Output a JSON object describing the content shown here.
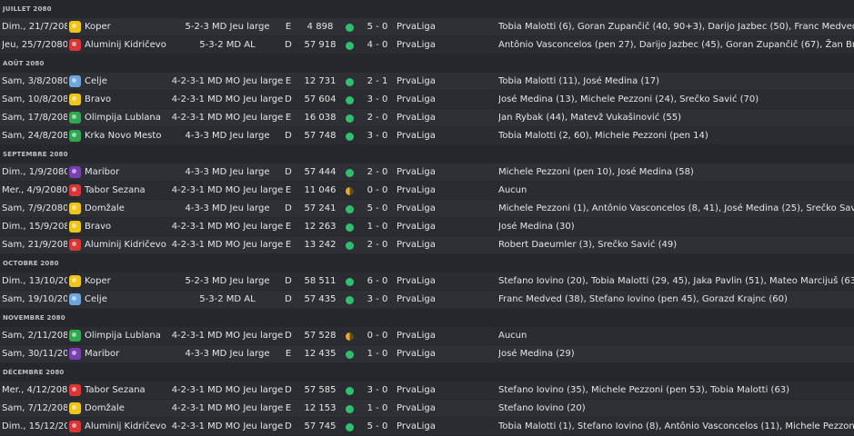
{
  "colors": {
    "win": "#2fbf6e",
    "draw": "#f0a91e"
  },
  "months": [
    {
      "label": "JUILLET 2080",
      "rows": [
        {
          "date": "Dim., 21/7/2080",
          "opponent": "Koper",
          "badge": "#f0c419",
          "tactic": "5-2-3 MD Jeu large",
          "venue": "E",
          "attendance": "4 898",
          "result": "win",
          "score": "5 - 0",
          "competition": "PrvaLiga",
          "scorers": "Tobia Malotti (6), Goran Zupančič (40, 90+3), Darijo Jazbec (50), Franc Medved (54)"
        },
        {
          "date": "Jeu, 25/7/2080",
          "opponent": "Aluminij Kidričevo",
          "badge": "#d93636",
          "tactic": "5-3-2 MD AL",
          "venue": "D",
          "attendance": "57 918",
          "result": "win",
          "score": "4 - 0",
          "competition": "PrvaLiga",
          "scorers": "Antônio Vasconcelos (pen 27), Darijo Jazbec (45), Goran Zupančič (67), Žan Brdik (83)"
        }
      ]
    },
    {
      "label": "AOÛT 2080",
      "rows": [
        {
          "date": "Sam, 3/8/2080",
          "opponent": "Celje",
          "badge": "#6aa7e0",
          "tactic": "4-2-3-1 MD MO Jeu large",
          "venue": "E",
          "attendance": "12 731",
          "result": "win",
          "score": "2 - 1",
          "competition": "PrvaLiga",
          "scorers": "Tobia Malotti (11), José Medina (17)"
        },
        {
          "date": "Sam, 10/8/2080",
          "opponent": "Bravo",
          "badge": "#f0c419",
          "tactic": "4-2-3-1 MD MO Jeu large",
          "venue": "D",
          "attendance": "57 604",
          "result": "win",
          "score": "3 - 0",
          "competition": "PrvaLiga",
          "scorers": "José Medina (13), Michele Pezzoni (24), Srečko Savić (70)"
        },
        {
          "date": "Sam, 17/8/2080",
          "opponent": "Olimpija Lublana",
          "badge": "#2fa84f",
          "tactic": "4-2-3-1 MD MO Jeu large",
          "venue": "E",
          "attendance": "16 038",
          "result": "win",
          "score": "2 - 0",
          "competition": "PrvaLiga",
          "scorers": "Jan Rybak (44), Matevž Vukašinović (55)"
        },
        {
          "date": "Sam, 24/8/2080",
          "opponent": "Krka Novo Mesto",
          "badge": "#2fa84f",
          "tactic": "4-3-3 MD Jeu large",
          "venue": "D",
          "attendance": "57 748",
          "result": "win",
          "score": "3 - 0",
          "competition": "PrvaLiga",
          "scorers": "Tobia Malotti (2, 60), Michele Pezzoni (pen 14)"
        }
      ]
    },
    {
      "label": "SEPTEMBRE 2080",
      "rows": [
        {
          "date": "Dim., 1/9/2080",
          "opponent": "Maribor",
          "badge": "#7a3fb0",
          "tactic": "4-3-3 MD Jeu large",
          "venue": "D",
          "attendance": "57 444",
          "result": "win",
          "score": "2 - 0",
          "competition": "PrvaLiga",
          "scorers": "Michele Pezzoni (pen 10), José Medina (58)"
        },
        {
          "date": "Mer., 4/9/2080",
          "opponent": "Tabor Sezana",
          "badge": "#d93636",
          "tactic": "4-2-3-1 MD MO Jeu large",
          "venue": "E",
          "attendance": "11 046",
          "result": "draw",
          "score": "0 - 0",
          "competition": "PrvaLiga",
          "scorers": "Aucun"
        },
        {
          "date": "Sam, 7/9/2080",
          "opponent": "Domžale",
          "badge": "#f0c419",
          "tactic": "4-3-3 MD Jeu large",
          "venue": "D",
          "attendance": "57 241",
          "result": "win",
          "score": "5 - 0",
          "competition": "PrvaLiga",
          "scorers": "Michele Pezzoni (1), Antônio Vasconcelos (8, 41), José Medina (25), Srečko Savić (55)"
        },
        {
          "date": "Dim., 15/9/2080",
          "opponent": "Bravo",
          "badge": "#f0c419",
          "tactic": "4-2-3-1 MD MO Jeu large",
          "venue": "E",
          "attendance": "12 263",
          "result": "win",
          "score": "1 - 0",
          "competition": "PrvaLiga",
          "scorers": "José Medina (30)"
        },
        {
          "date": "Sam, 21/9/2080",
          "opponent": "Aluminij Kidričevo",
          "badge": "#d93636",
          "tactic": "4-2-3-1 MD MO Jeu large",
          "venue": "E",
          "attendance": "13 242",
          "result": "win",
          "score": "2 - 0",
          "competition": "PrvaLiga",
          "scorers": "Robert Daeumler (3), Srečko Savić (49)"
        }
      ]
    },
    {
      "label": "OCTOBRE 2080",
      "rows": [
        {
          "date": "Dim., 13/10/2080",
          "opponent": "Koper",
          "badge": "#f0c419",
          "tactic": "5-2-3 MD Jeu large",
          "venue": "D",
          "attendance": "58 511",
          "result": "win",
          "score": "6 - 0",
          "competition": "PrvaLiga",
          "scorers": "Stefano Iovino (20), Tobia Malotti (29, 45), Jaka Pavlin (51), Mateo Marcijuš (63), Gorazd Kraj…"
        },
        {
          "date": "Sam, 19/10/2080",
          "opponent": "Celje",
          "badge": "#6aa7e0",
          "tactic": "5-3-2 MD AL",
          "venue": "D",
          "attendance": "57 435",
          "result": "win",
          "score": "3 - 0",
          "competition": "PrvaLiga",
          "scorers": "Franc Medved (38), Stefano Iovino (pen 45), Gorazd Krajnc (60)"
        }
      ]
    },
    {
      "label": "NOVEMBRE 2080",
      "rows": [
        {
          "date": "Sam, 2/11/2080",
          "opponent": "Olimpija Lublana",
          "badge": "#2fa84f",
          "tactic": "4-2-3-1 MD MO Jeu large",
          "venue": "D",
          "attendance": "57 528",
          "result": "draw",
          "score": "0 - 0",
          "competition": "PrvaLiga",
          "scorers": "Aucun"
        },
        {
          "date": "Sam, 30/11/2080",
          "opponent": "Maribor",
          "badge": "#7a3fb0",
          "tactic": "4-3-3 MD Jeu large",
          "venue": "E",
          "attendance": "12 435",
          "result": "win",
          "score": "1 - 0",
          "competition": "PrvaLiga",
          "scorers": "José Medina (29)"
        }
      ]
    },
    {
      "label": "DÉCEMBRE 2080",
      "rows": [
        {
          "date": "Mer., 4/12/2080",
          "opponent": "Tabor Sezana",
          "badge": "#d93636",
          "tactic": "4-2-3-1 MD MO Jeu large",
          "venue": "D",
          "attendance": "57 585",
          "result": "win",
          "score": "3 - 0",
          "competition": "PrvaLiga",
          "scorers": "Stefano Iovino (35), Michele Pezzoni (pen 53), Tobia Malotti (63)"
        },
        {
          "date": "Sam, 7/12/2080",
          "opponent": "Domžale",
          "badge": "#f0c419",
          "tactic": "4-2-3-1 MD MO Jeu large",
          "venue": "E",
          "attendance": "12 153",
          "result": "win",
          "score": "1 - 0",
          "competition": "PrvaLiga",
          "scorers": "Stefano Iovino (20)"
        },
        {
          "date": "Dim., 15/12/2080",
          "opponent": "Aluminij Kidričevo",
          "badge": "#d93636",
          "tactic": "4-2-3-1 MD MO Jeu large",
          "venue": "D",
          "attendance": "57 745",
          "result": "win",
          "score": "5 - 0",
          "competition": "PrvaLiga",
          "scorers": "Tobia Malotti (1), Stefano Iovino (8), Antônio Vasconcelos (11), Michele Pezzoni (23), José Med…"
        }
      ]
    }
  ]
}
